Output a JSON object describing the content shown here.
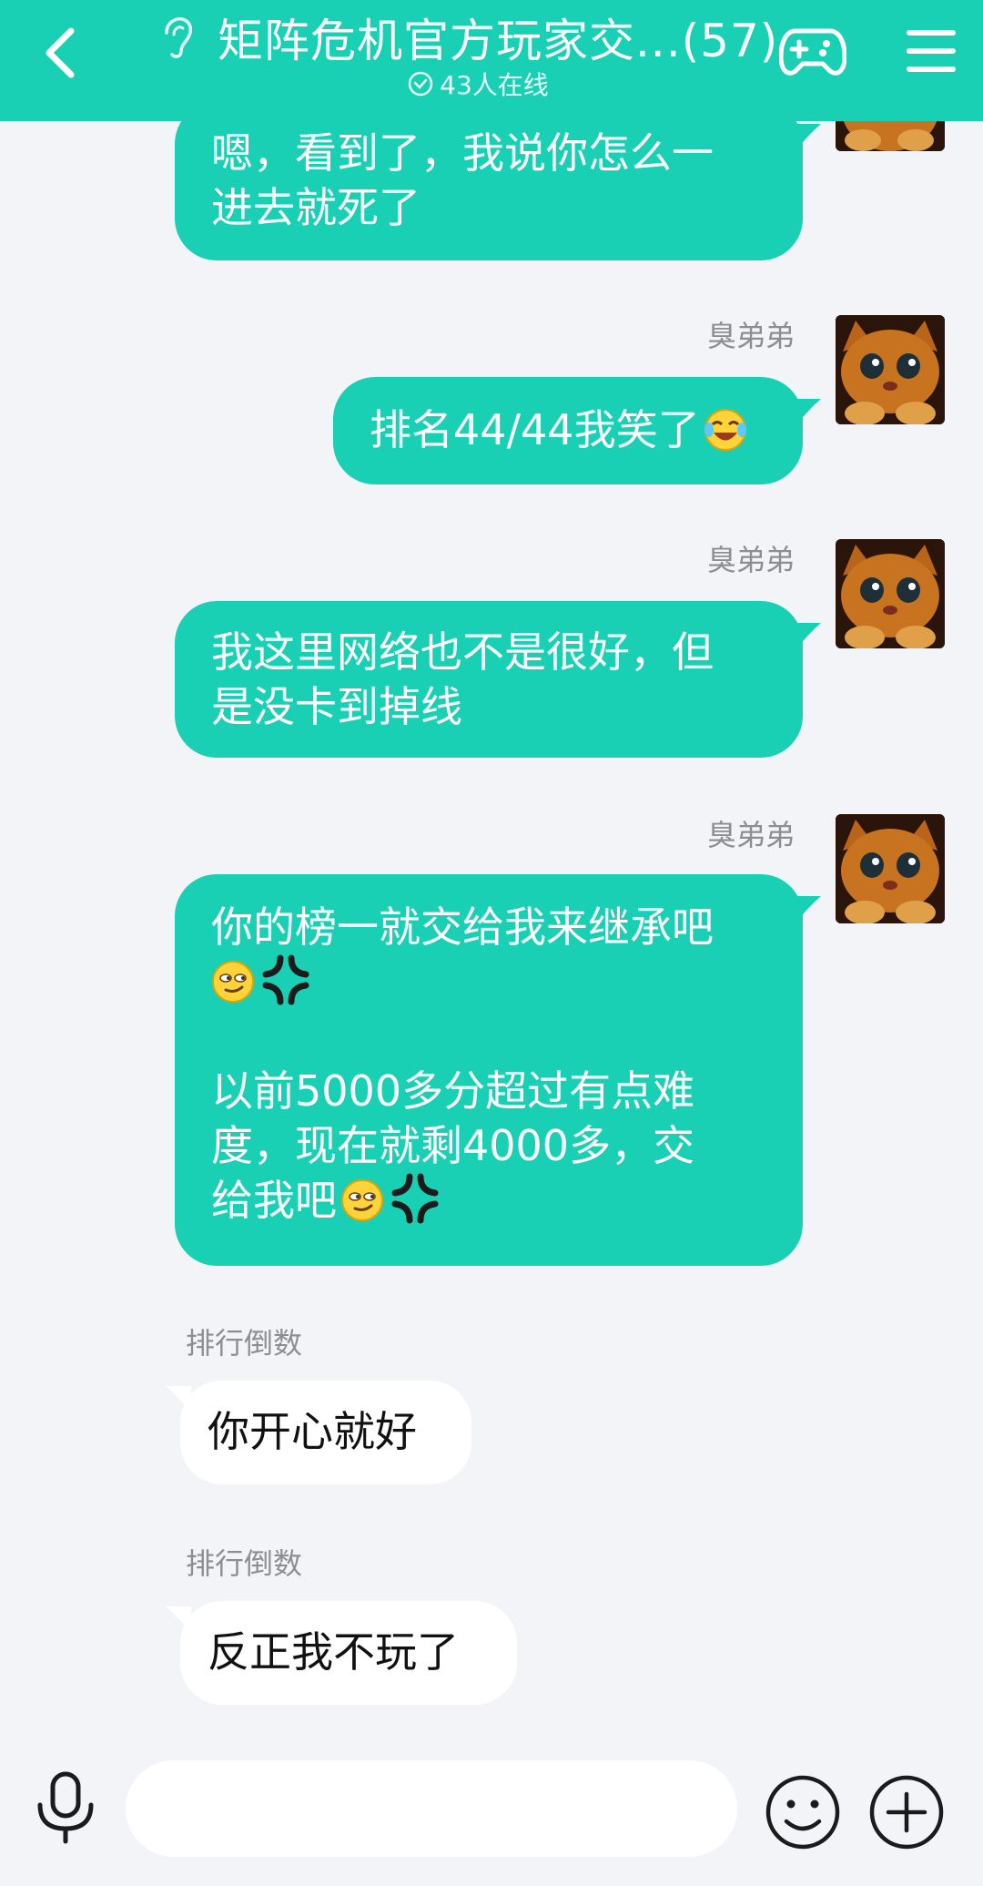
{
  "header": {
    "title": "矩阵危机官方玩家交...(57)",
    "online": "43人在线"
  },
  "messages": [
    {
      "sender": "",
      "side": "right",
      "text_lines": [
        "嗯，看到了，我说你怎么一",
        "进去就死了"
      ]
    },
    {
      "sender": "臭弟弟",
      "side": "right",
      "text": "排名44/44我笑了",
      "emoji": "tears-of-joy-emoji"
    },
    {
      "sender": "臭弟弟",
      "side": "right",
      "text_lines": [
        "我这里网络也不是很好，但",
        "是没卡到掉线"
      ]
    },
    {
      "sender": "臭弟弟",
      "side": "right",
      "line1": "你的榜一就交给我来继承吧",
      "line3": "以前5000多分超过有点难",
      "line4": "度，现在就剩4000多，交",
      "line5": "给我吧"
    },
    {
      "sender": "排行倒数",
      "side": "left",
      "text": "你开心就好"
    },
    {
      "sender": "排行倒数",
      "side": "left",
      "text": "反正我不玩了"
    }
  ],
  "input": {
    "placeholder": ""
  },
  "colors": {
    "accent": "#1ad0b4",
    "background": "#f3f4f8"
  }
}
